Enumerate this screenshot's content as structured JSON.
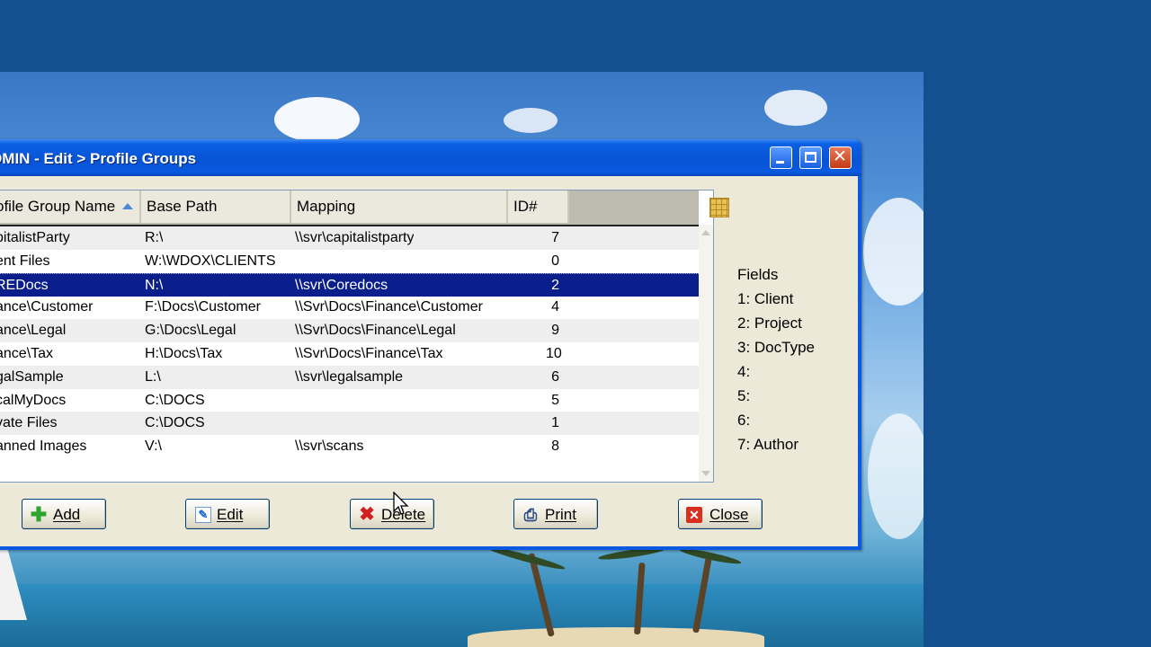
{
  "window": {
    "title": "DMIN - Edit > Profile Groups"
  },
  "table": {
    "columns": [
      "ofile Group Name",
      "Base Path",
      "Mapping",
      "ID#"
    ],
    "sort_column": "ofile Group Name",
    "selected_row": 2,
    "rows": [
      {
        "name": "pitalistParty",
        "base_path": "R:\\",
        "mapping": "\\\\svr\\capitalistparty",
        "id": "7"
      },
      {
        "name": "ent Files",
        "base_path": "W:\\WDOX\\CLIENTS",
        "mapping": "",
        "id": "0"
      },
      {
        "name": "REDocs",
        "base_path": "N:\\",
        "mapping": "\\\\svr\\Coredocs",
        "id": "2"
      },
      {
        "name": "ance\\Customer",
        "base_path": "F:\\Docs\\Customer",
        "mapping": "\\\\Svr\\Docs\\Finance\\Customer",
        "id": "4"
      },
      {
        "name": "ance\\Legal",
        "base_path": "G:\\Docs\\Legal",
        "mapping": "\\\\Svr\\Docs\\Finance\\Legal",
        "id": "9"
      },
      {
        "name": "ance\\Tax",
        "base_path": "H:\\Docs\\Tax",
        "mapping": "\\\\Svr\\Docs\\Finance\\Tax",
        "id": "10"
      },
      {
        "name": "galSample",
        "base_path": "L:\\",
        "mapping": "\\\\svr\\legalsample",
        "id": "6"
      },
      {
        "name": "calMyDocs",
        "base_path": "C:\\DOCS",
        "mapping": "",
        "id": "5"
      },
      {
        "name": "vate Files",
        "base_path": "C:\\DOCS",
        "mapping": "",
        "id": "1"
      },
      {
        "name": "anned Images",
        "base_path": "V:\\",
        "mapping": "\\\\svr\\scans",
        "id": "8"
      }
    ]
  },
  "fields": {
    "title": "Fields",
    "items": [
      "1: Client",
      "2: Project",
      "3: DocType",
      "4:",
      "5:",
      "6:",
      "7: Author"
    ]
  },
  "buttons": {
    "add": "Add",
    "edit": "Edit",
    "delete": "Delete",
    "print": "Print",
    "close": "Close"
  },
  "colors": {
    "titlebar": "#0754d6",
    "selection": "#0a1f8c",
    "dialog_bg": "#ece9d8"
  },
  "icons": {
    "minimize": "minimize-icon",
    "maximize": "maximize-icon",
    "close": "close-icon",
    "grid": "grid-icon",
    "add": "plus-icon",
    "edit": "pencil-icon",
    "delete": "x-icon",
    "print": "printer-icon",
    "close_button": "close-x-icon"
  }
}
